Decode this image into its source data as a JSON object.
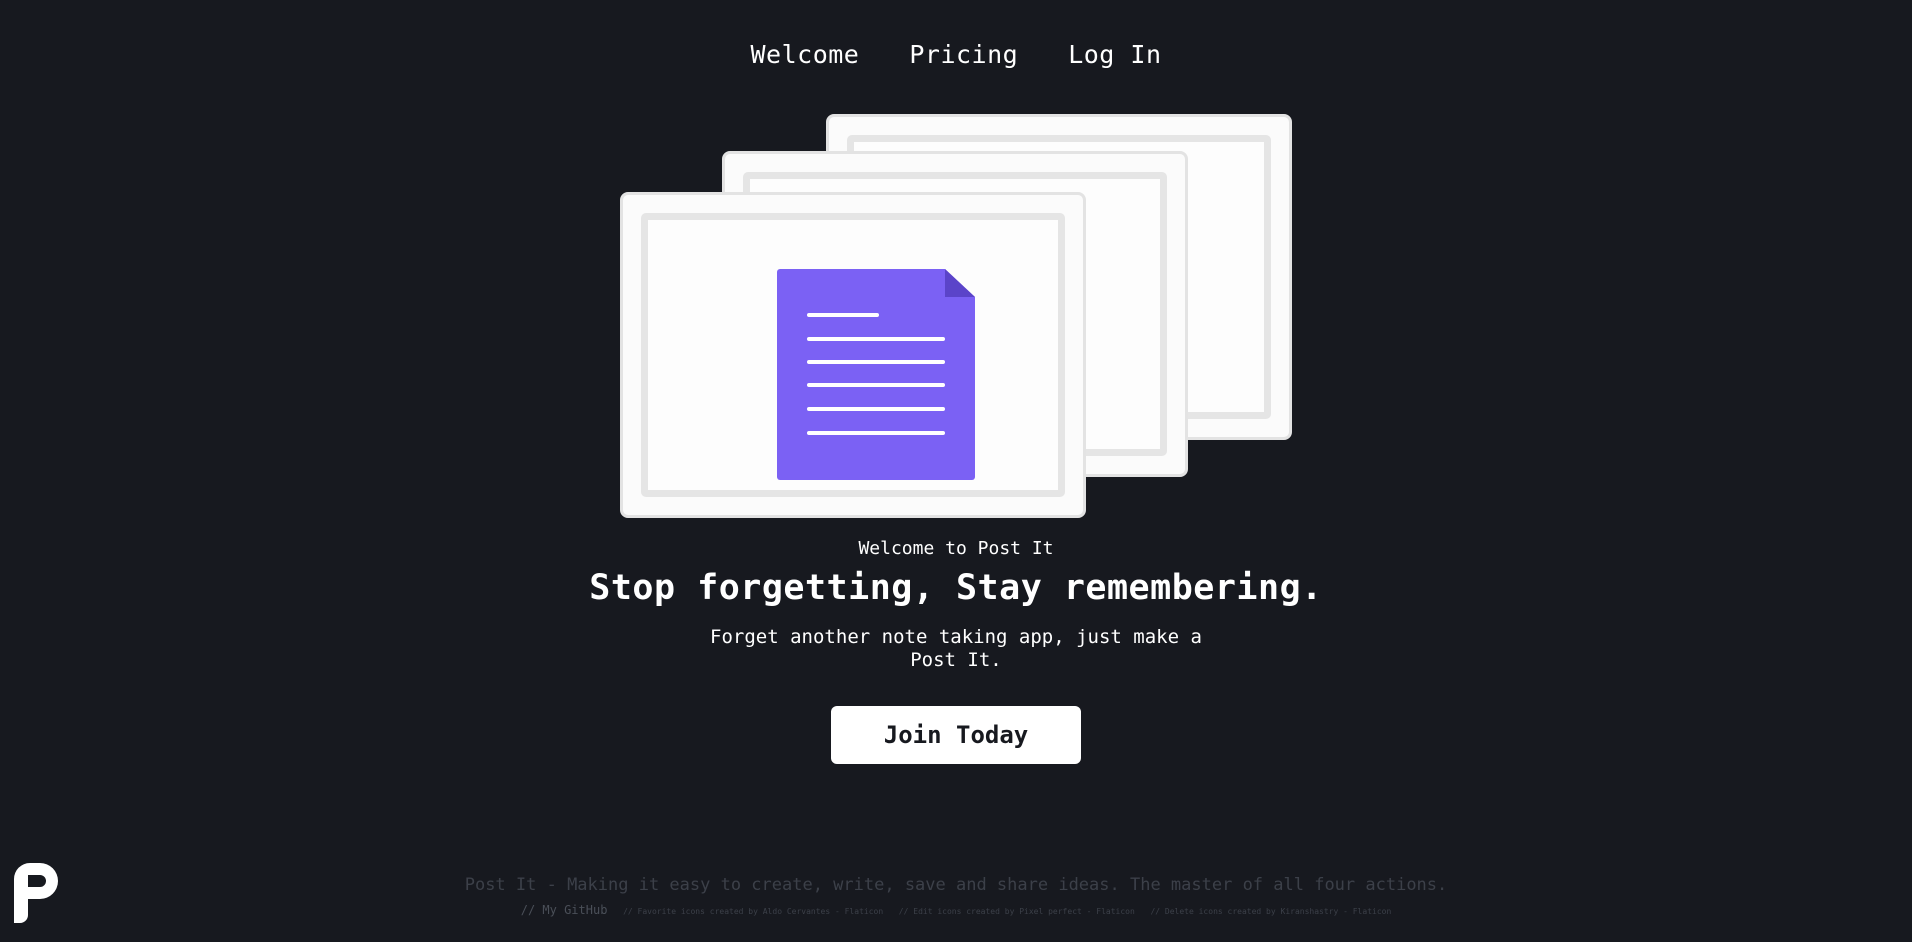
{
  "nav": {
    "items": [
      {
        "label": "Welcome"
      },
      {
        "label": "Pricing"
      },
      {
        "label": "Log In"
      }
    ]
  },
  "hero": {
    "eyebrow": "Welcome to Post It",
    "headline": "Stop forgetting, Stay remembering.",
    "subtitle": "Forget another note taking app, just make a Post It.",
    "cta_label": "Join Today"
  },
  "illustration": {
    "icon": "document-icon",
    "accent_color": "#7b61f4"
  },
  "footer": {
    "tagline": "Post It - Making it easy to create, write, save and share ideas. The master of all four actions.",
    "github_label": "// My GitHub",
    "credits": [
      "// Favorite icons created by Aldo Cervantes - Flaticon",
      "// Edit icons created by Pixel perfect - Flaticon",
      "// Delete icons created by Kiranshastry - Flaticon"
    ]
  },
  "colors": {
    "background": "#17191f",
    "text": "#ffffff",
    "muted": "#3c4049"
  }
}
